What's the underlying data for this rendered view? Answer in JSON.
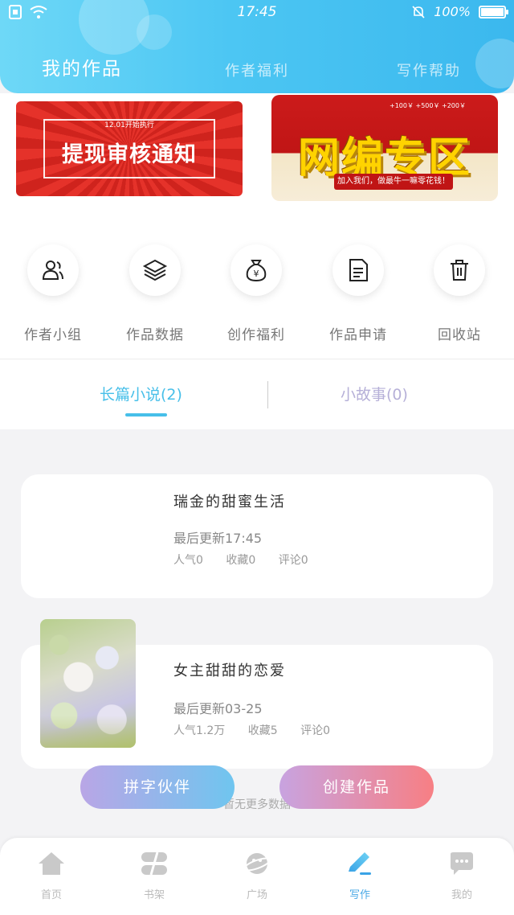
{
  "status_bar": {
    "time": "17:45",
    "battery_text": "100%",
    "icons": [
      "sim-icon",
      "wifi-icon",
      "mute-bell-icon",
      "battery-icon"
    ]
  },
  "header": {
    "tabs": [
      {
        "label": "我的作品",
        "active": true
      },
      {
        "label": "作者福利",
        "active": false
      },
      {
        "label": "写作帮助",
        "active": false
      }
    ]
  },
  "banners": {
    "left": {
      "small": "12.01开始执行",
      "title": "提现审核通知"
    },
    "right": {
      "title": "网编专区",
      "tagline": "加入我们，做最牛一嘛零花钱！",
      "numbers": "+100￥  +500￥  +200￥"
    }
  },
  "features": [
    {
      "label": "作者小组",
      "icon": "user-group-icon"
    },
    {
      "label": "作品数据",
      "icon": "layers-icon"
    },
    {
      "label": "创作福利",
      "icon": "money-bag-icon"
    },
    {
      "label": "作品申请",
      "icon": "document-icon"
    },
    {
      "label": "回收站",
      "icon": "trash-icon"
    }
  ],
  "sub_tabs": [
    {
      "label": "长篇小说(2)",
      "active": true
    },
    {
      "label": "小故事(0)",
      "active": false
    }
  ],
  "works": [
    {
      "title": "瑞金的甜蜜生活",
      "update": "最后更新17:45",
      "popularity": "人气0",
      "favorites": "收藏0",
      "comments": "评论0",
      "has_cover": false
    },
    {
      "title": "女主甜甜的恋爱",
      "update": "最后更新03-25",
      "popularity": "人气1.2万",
      "favorites": "收藏5",
      "comments": "评论0",
      "has_cover": true
    }
  ],
  "no_more": "暂无更多数据",
  "actions": {
    "left": "拼字伙伴",
    "right": "创建作品"
  },
  "bottom_nav": [
    {
      "label": "首页",
      "icon": "home-icon",
      "active": false
    },
    {
      "label": "书架",
      "icon": "bookshelf-icon",
      "active": false
    },
    {
      "label": "广场",
      "icon": "planet-icon",
      "active": false
    },
    {
      "label": "写作",
      "icon": "pen-icon",
      "active": true
    },
    {
      "label": "我的",
      "icon": "chat-bubble-icon",
      "active": false
    }
  ],
  "colors": {
    "header_gradient_start": "#6ed8f7",
    "header_gradient_end": "#3bb8ee",
    "active_tab": "#47bfe9",
    "inactive_tab": "#b6b0d8",
    "nav_active": "#4aa9e6"
  }
}
